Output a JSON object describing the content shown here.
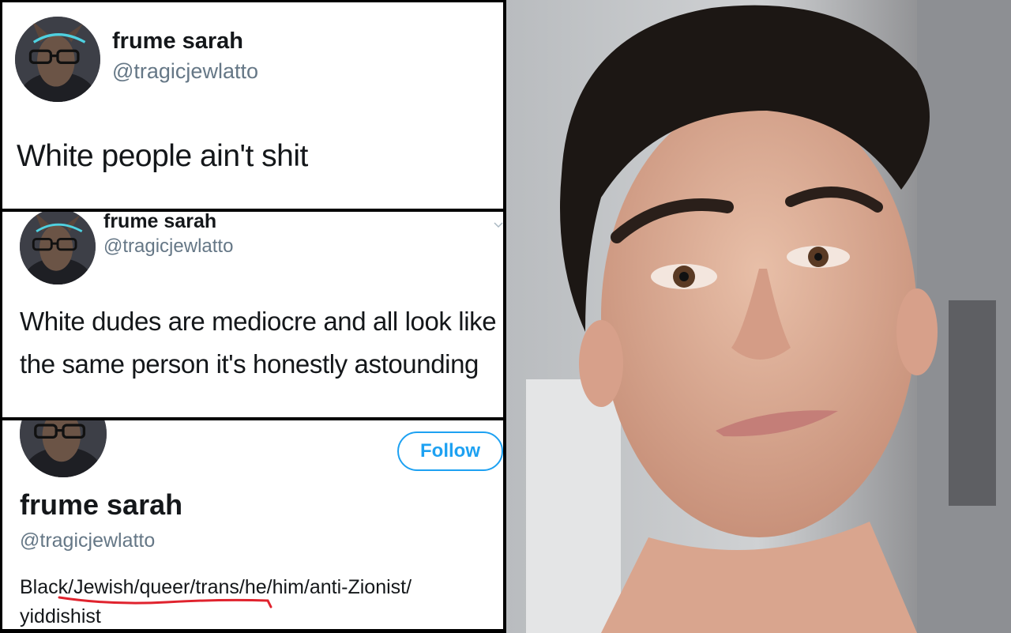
{
  "tweet1": {
    "display_name": "frume sarah",
    "handle": "@tragicjewlatto",
    "text": "White people ain't shit"
  },
  "tweet2": {
    "display_name": "frume sarah",
    "handle": "@tragicjewlatto",
    "text": "White dudes are mediocre and all look like the same person it's honestly astounding"
  },
  "profile": {
    "follow_label": "Follow",
    "display_name": "frume sarah",
    "handle": "@tragicjewlatto",
    "bio": "Black/Jewish/queer/trans/he/him/anti-Zionist/ yiddishist"
  },
  "colors": {
    "link_blue": "#1da1f2",
    "handle_gray": "#657786",
    "underline_red": "#e0232e"
  },
  "icons": {
    "dropdown": "chevron-down-icon"
  }
}
